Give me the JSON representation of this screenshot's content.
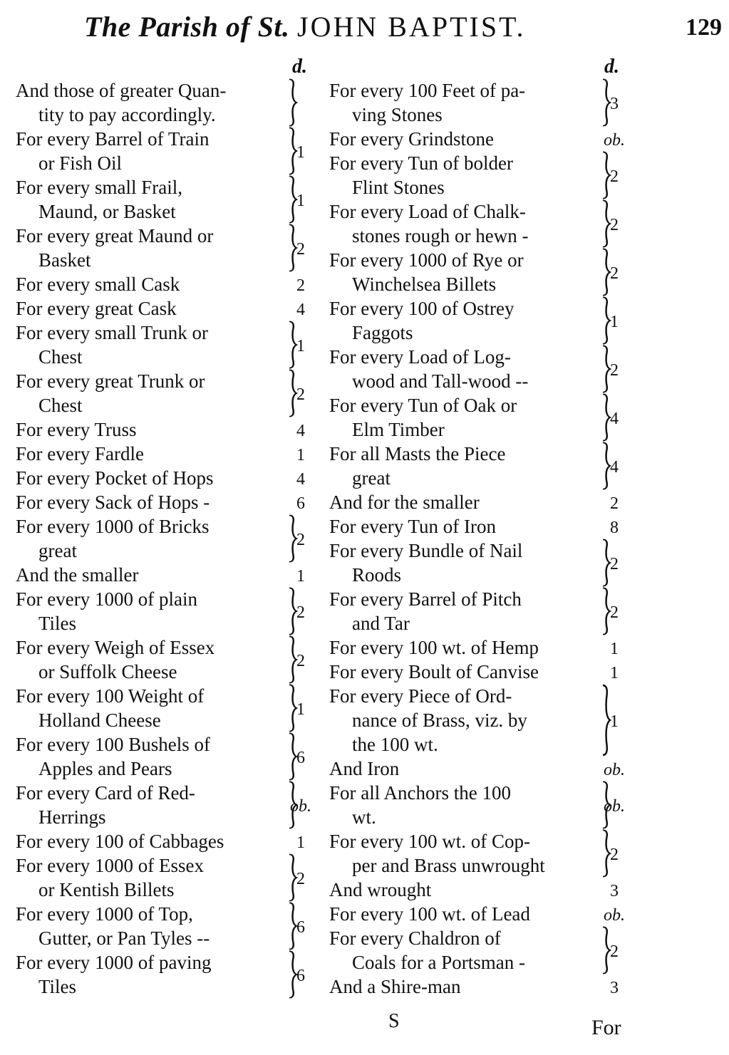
{
  "header": {
    "title_italic": "The Parish of St.",
    "title_caps": "JOHN BAPTIST.",
    "page_number": "129",
    "column_unit_left": "d.",
    "column_unit_right": "d."
  },
  "left_column": [
    {
      "lines": [
        "And those of greater Quan-",
        "tity to pay accordingly."
      ],
      "value": ""
    },
    {
      "lines": [
        "For every Barrel of Train",
        "or Fish Oil"
      ],
      "value": "1"
    },
    {
      "lines": [
        "For every small Frail,",
        "Maund, or Basket"
      ],
      "value": "1"
    },
    {
      "lines": [
        "For every great Maund or",
        "Basket"
      ],
      "value": "2"
    },
    {
      "lines": [
        "For every small Cask"
      ],
      "value": "2"
    },
    {
      "lines": [
        "For every great Cask"
      ],
      "value": "4"
    },
    {
      "lines": [
        "For every small Trunk or",
        "Chest"
      ],
      "value": "1"
    },
    {
      "lines": [
        "For every great Trunk or",
        "Chest"
      ],
      "value": "2"
    },
    {
      "lines": [
        "For every Truss"
      ],
      "value": "4"
    },
    {
      "lines": [
        "For every Fardle"
      ],
      "value": "1"
    },
    {
      "lines": [
        "For every Pocket of Hops"
      ],
      "value": "4"
    },
    {
      "lines": [
        "For every Sack of Hops -"
      ],
      "value": "6"
    },
    {
      "lines": [
        "For every 1000 of Bricks",
        "great"
      ],
      "value": "2"
    },
    {
      "lines": [
        "And the smaller"
      ],
      "value": "1"
    },
    {
      "lines": [
        "For every 1000 of plain",
        "Tiles"
      ],
      "value": "2"
    },
    {
      "lines": [
        "For every Weigh of Essex",
        "or Suffolk Cheese"
      ],
      "value": "2"
    },
    {
      "lines": [
        "For every 100 Weight of",
        "Holland Cheese"
      ],
      "value": "1"
    },
    {
      "lines": [
        "For every 100 Bushels of",
        "Apples and Pears"
      ],
      "value": "6"
    },
    {
      "lines": [
        "For every Card of Red-",
        "Herrings"
      ],
      "value": "ob."
    },
    {
      "lines": [
        "For every 100 of Cabbages"
      ],
      "value": "1"
    },
    {
      "lines": [
        "For every 1000 of Essex",
        "or Kentish Billets"
      ],
      "value": "2"
    },
    {
      "lines": [
        "For every 1000 of Top,",
        "Gutter, or Pan Tyles --"
      ],
      "value": "6"
    },
    {
      "lines": [
        "For every 1000 of paving",
        "Tiles"
      ],
      "value": "6"
    }
  ],
  "right_column": [
    {
      "lines": [
        "For every 100 Feet of pa-",
        "ving Stones"
      ],
      "value": "3"
    },
    {
      "lines": [
        "For every Grindstone"
      ],
      "value": "ob."
    },
    {
      "lines": [
        "For every Tun of bolder",
        "Flint Stones"
      ],
      "value": "2"
    },
    {
      "lines": [
        "For every Load of Chalk-",
        "stones rough or hewn -"
      ],
      "value": "2"
    },
    {
      "lines": [
        "For every 1000 of Rye or",
        "Winchelsea Billets"
      ],
      "value": "2"
    },
    {
      "lines": [
        "For every 100 of Ostrey",
        "Faggots"
      ],
      "value": "1"
    },
    {
      "lines": [
        "For every Load of Log-",
        "wood and Tall-wood --"
      ],
      "value": "2"
    },
    {
      "lines": [
        "For every Tun of Oak or",
        "Elm Timber"
      ],
      "value": "4"
    },
    {
      "lines": [
        "For all Masts the Piece",
        "great"
      ],
      "value": "4"
    },
    {
      "lines": [
        "And for the smaller"
      ],
      "value": "2"
    },
    {
      "lines": [
        "For every Tun of Iron"
      ],
      "value": "8"
    },
    {
      "lines": [
        "For every Bundle of Nail",
        "Roods"
      ],
      "value": "2"
    },
    {
      "lines": [
        "For every Barrel of Pitch",
        "and Tar"
      ],
      "value": "2"
    },
    {
      "lines": [
        "For every 100 wt. of Hemp"
      ],
      "value": "1"
    },
    {
      "lines": [
        "For every Boult of Canvise"
      ],
      "value": "1"
    },
    {
      "lines": [
        "For every Piece of Ord-",
        "nance of Brass, viz. by",
        "the 100 wt."
      ],
      "value": "1"
    },
    {
      "lines": [
        "And Iron"
      ],
      "value": "ob."
    },
    {
      "lines": [
        "For all Anchors the 100",
        "wt."
      ],
      "value": "ob."
    },
    {
      "lines": [
        "For every 100 wt. of Cop-",
        "per and Brass unwrought"
      ],
      "value": "2"
    },
    {
      "lines": [
        "And wrought"
      ],
      "value": "3"
    },
    {
      "lines": [
        "For every 100 wt. of Lead"
      ],
      "value": "ob."
    },
    {
      "lines": [
        "For every Chaldron of",
        "Coals for a Portsman -"
      ],
      "value": "2"
    },
    {
      "lines": [
        "And a Shire-man"
      ],
      "value": "3"
    }
  ],
  "footer": {
    "signature_mark": "S",
    "catchword": "For"
  }
}
